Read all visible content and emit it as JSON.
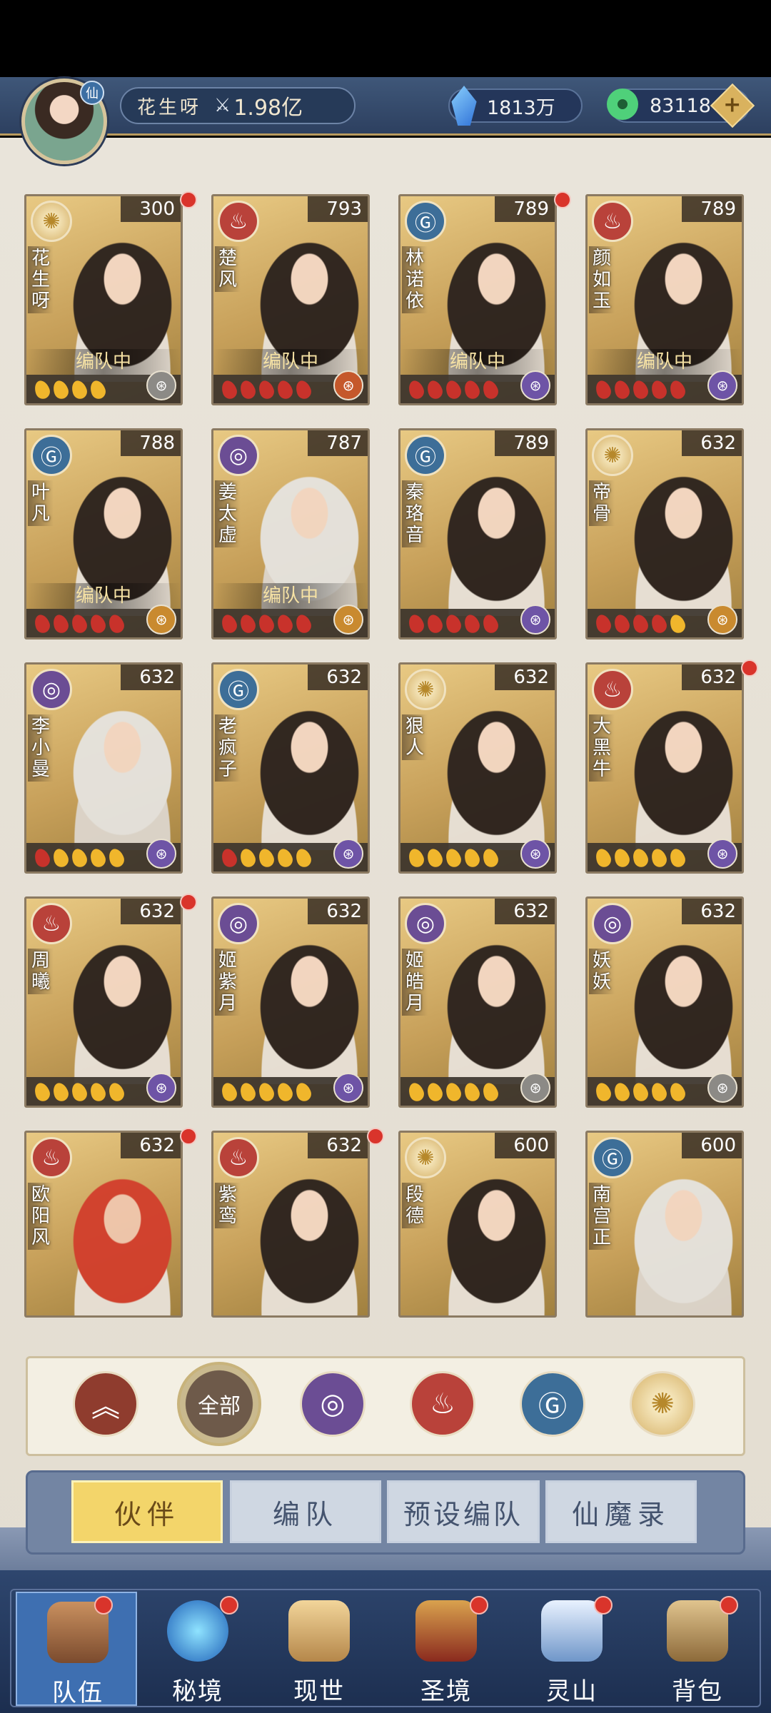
{
  "player": {
    "name": "花生呀",
    "power": "1.98亿",
    "badge": "仙"
  },
  "currencies": [
    {
      "name": "crystal",
      "value": "1813万"
    },
    {
      "name": "jade",
      "value": "83118"
    }
  ],
  "partners": [
    {
      "name": "花生呀",
      "level": "300",
      "element": "light",
      "in_team": true,
      "badge_text": "编队中",
      "drops": [
        "y",
        "y",
        "y",
        "y"
      ],
      "seal": "gray",
      "red_dot": true
    },
    {
      "name": "楚风",
      "level": "793",
      "element": "fire",
      "in_team": true,
      "badge_text": "编队中",
      "drops": [
        "r",
        "r",
        "r",
        "r",
        "r"
      ],
      "seal": "orange",
      "red_dot": false
    },
    {
      "name": "林诺依",
      "level": "789",
      "element": "water",
      "in_team": true,
      "badge_text": "编队中",
      "drops": [
        "r",
        "r",
        "r",
        "r",
        "r"
      ],
      "seal": "purple",
      "red_dot": true
    },
    {
      "name": "颜如玉",
      "level": "789",
      "element": "fire",
      "in_team": true,
      "badge_text": "编队中",
      "drops": [
        "r",
        "r",
        "r",
        "r",
        "r"
      ],
      "seal": "purple",
      "red_dot": false
    },
    {
      "name": "叶凡",
      "level": "788",
      "element": "water",
      "in_team": true,
      "badge_text": "编队中",
      "drops": [
        "r",
        "r",
        "r",
        "r",
        "r"
      ],
      "seal": "gold",
      "red_dot": false
    },
    {
      "name": "姜太虚",
      "level": "787",
      "element": "wind",
      "in_team": true,
      "badge_text": "编队中",
      "drops": [
        "r",
        "r",
        "r",
        "r",
        "r"
      ],
      "seal": "gold",
      "red_dot": false
    },
    {
      "name": "秦珞音",
      "level": "789",
      "element": "water",
      "in_team": false,
      "badge_text": "",
      "drops": [
        "r",
        "r",
        "r",
        "r",
        "r"
      ],
      "seal": "purple",
      "red_dot": false
    },
    {
      "name": "帝骨",
      "level": "632",
      "element": "light",
      "in_team": false,
      "badge_text": "",
      "drops": [
        "r",
        "r",
        "r",
        "r",
        "y"
      ],
      "seal": "gold",
      "red_dot": false
    },
    {
      "name": "李小曼",
      "level": "632",
      "element": "wind",
      "in_team": false,
      "badge_text": "",
      "drops": [
        "r",
        "y",
        "y",
        "y",
        "y"
      ],
      "seal": "purple",
      "red_dot": false
    },
    {
      "name": "老疯子",
      "level": "632",
      "element": "water",
      "in_team": false,
      "badge_text": "",
      "drops": [
        "r",
        "y",
        "y",
        "y",
        "y"
      ],
      "seal": "purple",
      "red_dot": false
    },
    {
      "name": "狠人",
      "level": "632",
      "element": "light",
      "in_team": false,
      "badge_text": "",
      "drops": [
        "y",
        "y",
        "y",
        "y",
        "y"
      ],
      "seal": "purple",
      "red_dot": false
    },
    {
      "name": "大黑牛",
      "level": "632",
      "element": "fire",
      "in_team": false,
      "badge_text": "",
      "drops": [
        "y",
        "y",
        "y",
        "y",
        "y"
      ],
      "seal": "purple",
      "red_dot": true
    },
    {
      "name": "周曦",
      "level": "632",
      "element": "fire",
      "in_team": false,
      "badge_text": "",
      "drops": [
        "y",
        "y",
        "y",
        "y",
        "y"
      ],
      "seal": "purple",
      "red_dot": true
    },
    {
      "name": "姬紫月",
      "level": "632",
      "element": "wind",
      "in_team": false,
      "badge_text": "",
      "drops": [
        "y",
        "y",
        "y",
        "y",
        "y"
      ],
      "seal": "purple",
      "red_dot": false
    },
    {
      "name": "姬皓月",
      "level": "632",
      "element": "wind",
      "in_team": false,
      "badge_text": "",
      "drops": [
        "y",
        "y",
        "y",
        "y",
        "y"
      ],
      "seal": "gray",
      "red_dot": false
    },
    {
      "name": "妖妖",
      "level": "632",
      "element": "wind",
      "in_team": false,
      "badge_text": "",
      "drops": [
        "y",
        "y",
        "y",
        "y",
        "y"
      ],
      "seal": "gray",
      "red_dot": false
    },
    {
      "name": "欧阳风",
      "level": "632",
      "element": "fire",
      "in_team": false,
      "badge_text": "",
      "drops": [],
      "seal": "",
      "red_dot": true
    },
    {
      "name": "紫鸾",
      "level": "632",
      "element": "fire",
      "in_team": false,
      "badge_text": "",
      "drops": [],
      "seal": "",
      "red_dot": true
    },
    {
      "name": "段德",
      "level": "600",
      "element": "light",
      "in_team": false,
      "badge_text": "",
      "drops": [],
      "seal": "",
      "red_dot": false
    },
    {
      "name": "南宫正",
      "level": "600",
      "element": "water",
      "in_team": false,
      "badge_text": "",
      "drops": [],
      "seal": "",
      "red_dot": false
    }
  ],
  "filters": {
    "all_label": "全部",
    "items": [
      "up",
      "all",
      "wind",
      "fire",
      "water",
      "light"
    ]
  },
  "tabs": [
    {
      "label": "伙伴",
      "active": true
    },
    {
      "label": "编队",
      "active": false
    },
    {
      "label": "预设编队",
      "active": false
    },
    {
      "label": "仙魔录",
      "active": false
    }
  ],
  "nav": [
    {
      "label": "队伍",
      "active": true
    },
    {
      "label": "秘境",
      "active": false
    },
    {
      "label": "现世",
      "active": false
    },
    {
      "label": "圣境",
      "active": false
    },
    {
      "label": "灵山",
      "active": false
    },
    {
      "label": "背包",
      "active": false
    }
  ],
  "colors": {
    "fire": "#b9423a",
    "water": "#3d6e98",
    "wind": "#6b4d94",
    "light": "#d5b066",
    "active_tab": "#f3d56a",
    "nav_bg": "#2e466e"
  }
}
